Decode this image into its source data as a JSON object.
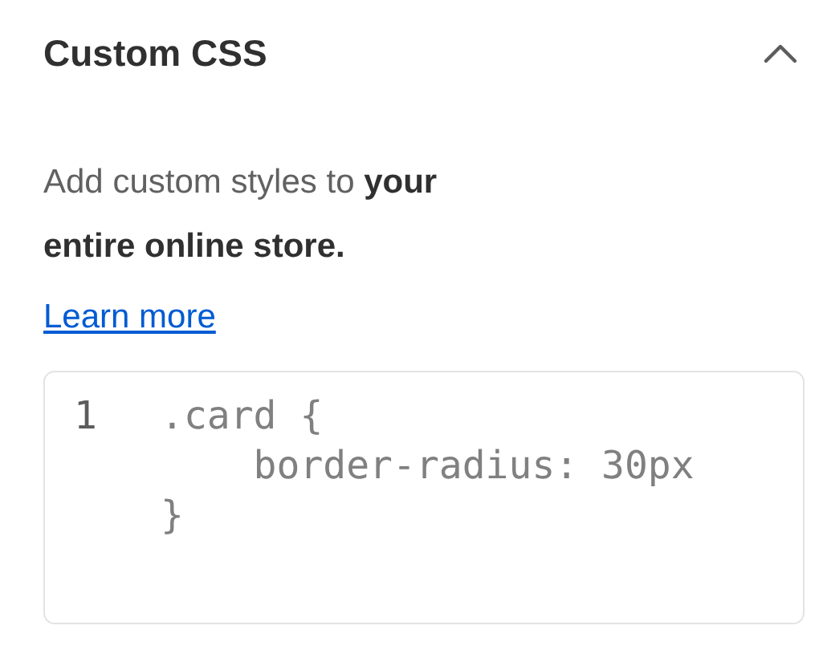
{
  "section": {
    "title": "Custom CSS",
    "expanded": true,
    "description": "Add custom styles to **your entire online store.**",
    "link": "Learn more",
    "code_editor": {
      "line_numbers": [
        "1"
      ],
      "lines": [
        ".card {",
        "    border-radius: 30px",
        "}"
      ]
    }
  }
}
